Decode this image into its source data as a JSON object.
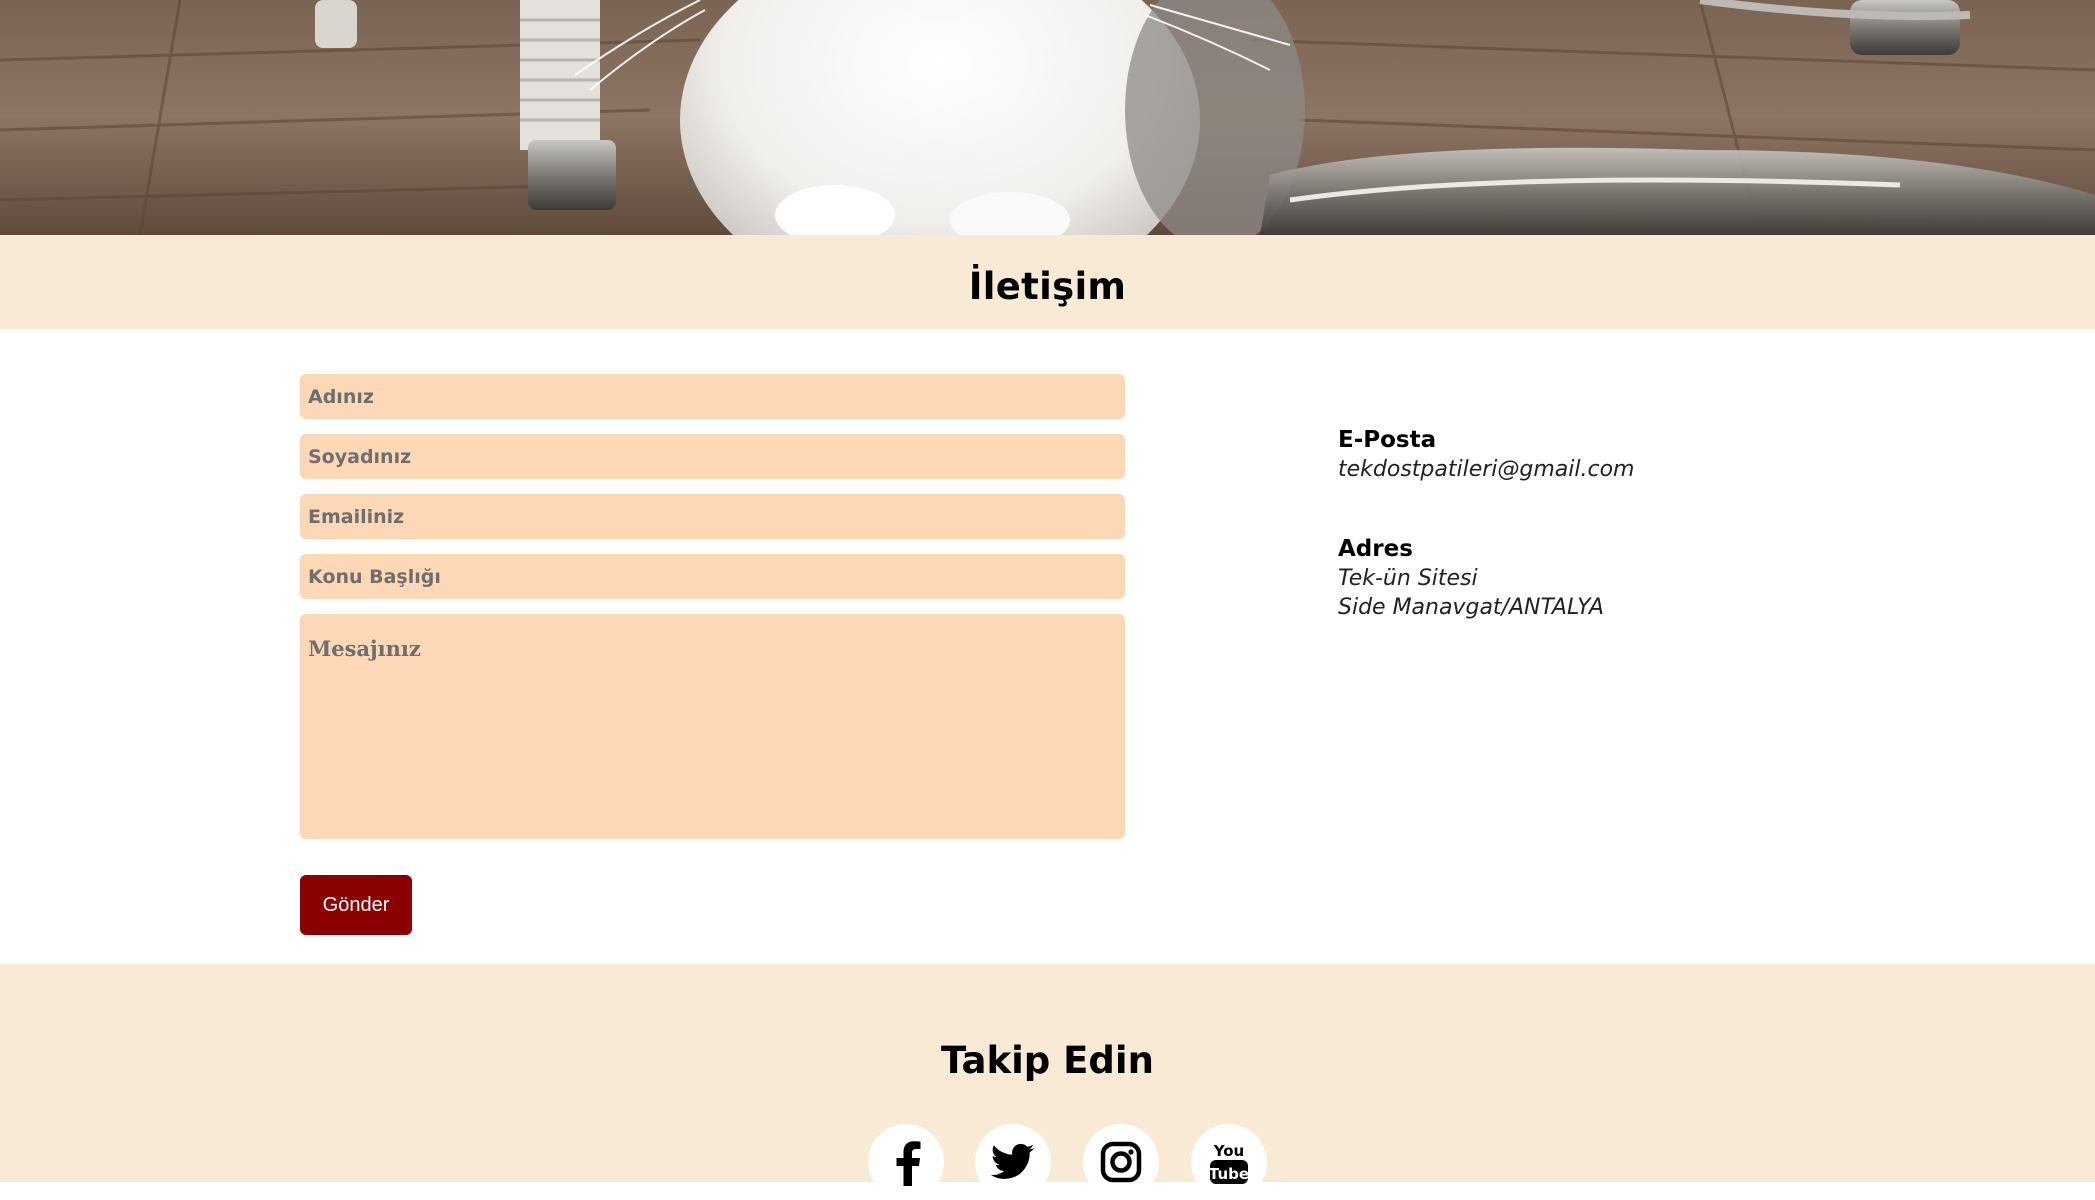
{
  "contact": {
    "title": "İletişim"
  },
  "form": {
    "first_name_placeholder": "Adınız",
    "last_name_placeholder": "Soyadınız",
    "email_placeholder": "Emailiniz",
    "subject_placeholder": "Konu Başlığı",
    "message_placeholder": "Mesajınız",
    "submit_label": "Gönder"
  },
  "info": {
    "email_label": "E-Posta",
    "email_value": "tekdostpatileri@gmail.com",
    "address_label": "Adres",
    "address_line1": "Tek-ün Sitesi",
    "address_line2": "Side Manavgat/ANTALYA"
  },
  "follow": {
    "title": "Takip Edin",
    "icons": [
      "facebook-icon",
      "twitter-icon",
      "instagram-icon",
      "youtube-icon"
    ]
  },
  "colors": {
    "header_bg": "#f9ead6",
    "input_bg": "#fdd8b7",
    "button_bg": "#8b0000"
  }
}
